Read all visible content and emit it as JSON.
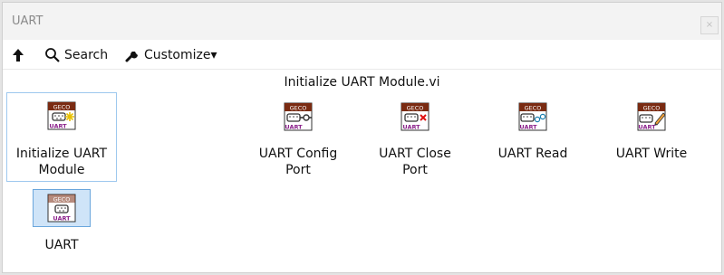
{
  "window": {
    "title": "UART",
    "close_glyph": "×"
  },
  "toolbar": {
    "up_icon": "arrow-up-icon",
    "search_label": "Search",
    "customize_label": "Customize▾"
  },
  "palette": {
    "caption": "Initialize UART Module.vi",
    "items": [
      {
        "label": "Initialize UART\nModule",
        "badge": "GECO",
        "sublabel": "UART",
        "glyph": "spark"
      },
      {
        "label": "UART Config\nPort",
        "badge": "GECO",
        "sublabel": "UART",
        "glyph": "plug"
      },
      {
        "label": "UART Close\nPort",
        "badge": "GECO",
        "sublabel": "UART",
        "glyph": "x"
      },
      {
        "label": "UART Read",
        "badge": "GECO",
        "sublabel": "UART",
        "glyph": "glasses"
      },
      {
        "label": "UART Write",
        "badge": "GECO",
        "sublabel": "UART",
        "glyph": "pencil"
      },
      {
        "label": "UART",
        "badge": "GECO",
        "sublabel": "UART",
        "glyph": "none"
      }
    ]
  },
  "colors": {
    "badge_brown": "#7a2b12",
    "uart_purple": "#8a1f8a",
    "selection_border": "#9ec8ee",
    "highlight_fill": "#cfe4f8"
  }
}
